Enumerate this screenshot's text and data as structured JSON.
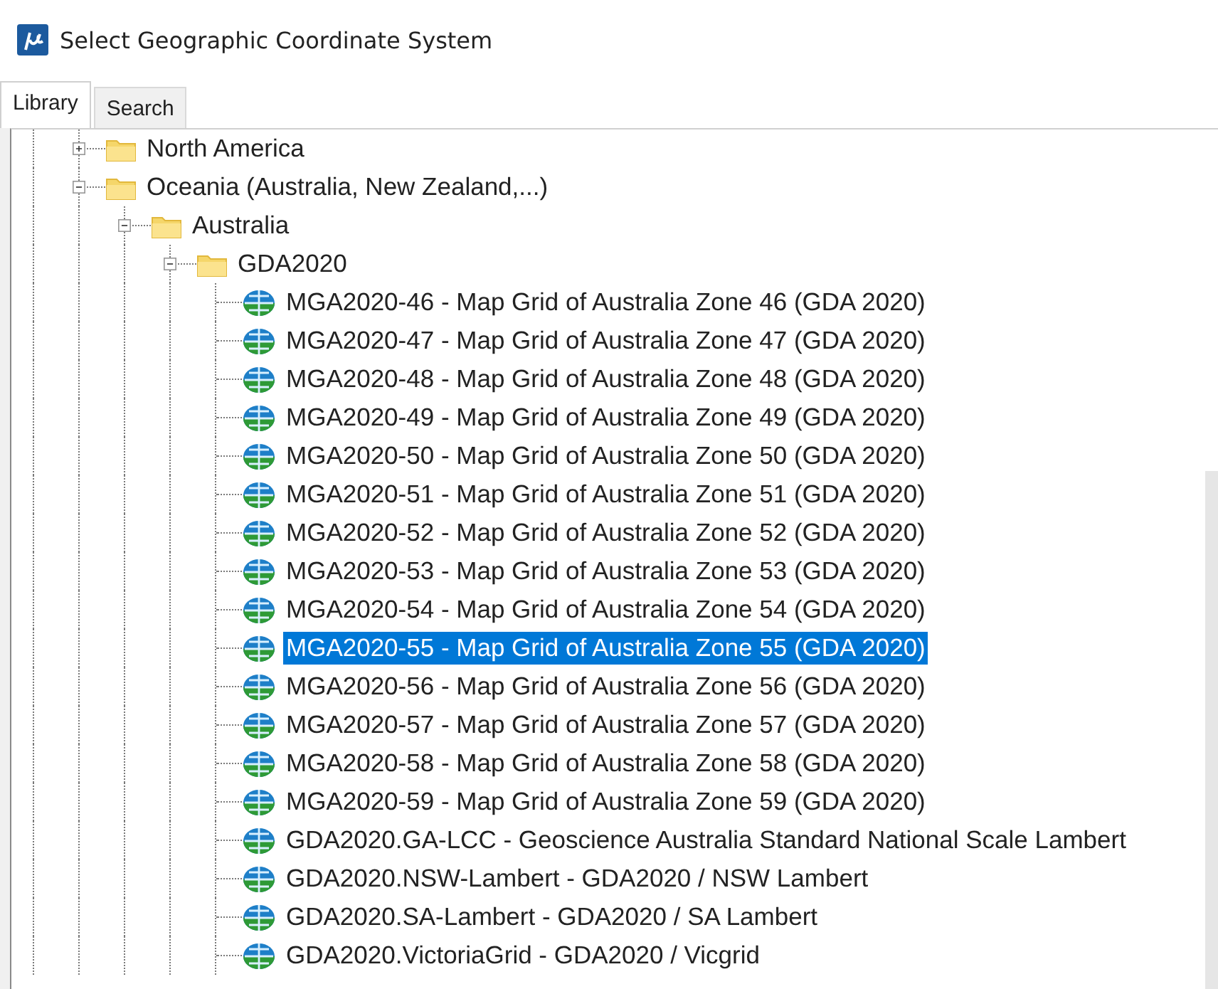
{
  "window": {
    "title": "Select Geographic Coordinate System"
  },
  "tabs": [
    {
      "label": "Library",
      "selected": true
    },
    {
      "label": "Search",
      "selected": false
    }
  ],
  "tree": [
    {
      "kind": "folder",
      "label": "North America",
      "expanded": false,
      "selected": false
    },
    {
      "kind": "folder",
      "label": "Oceania (Australia, New Zealand,...)",
      "expanded": true,
      "selected": false,
      "children": [
        {
          "kind": "folder",
          "label": "Australia",
          "expanded": true,
          "selected": false,
          "children": [
            {
              "kind": "folder",
              "label": "GDA2020",
              "expanded": true,
              "selected": false,
              "children": [
                {
                  "kind": "system",
                  "label": "MGA2020-46 - Map Grid of Australia Zone 46 (GDA 2020)",
                  "selected": false
                },
                {
                  "kind": "system",
                  "label": "MGA2020-47 - Map Grid of Australia Zone 47 (GDA 2020)",
                  "selected": false
                },
                {
                  "kind": "system",
                  "label": "MGA2020-48 - Map Grid of Australia Zone 48 (GDA 2020)",
                  "selected": false
                },
                {
                  "kind": "system",
                  "label": "MGA2020-49 - Map Grid of Australia Zone 49 (GDA 2020)",
                  "selected": false
                },
                {
                  "kind": "system",
                  "label": "MGA2020-50 - Map Grid of Australia Zone 50 (GDA 2020)",
                  "selected": false
                },
                {
                  "kind": "system",
                  "label": "MGA2020-51 - Map Grid of Australia Zone 51 (GDA 2020)",
                  "selected": false
                },
                {
                  "kind": "system",
                  "label": "MGA2020-52 - Map Grid of Australia Zone 52 (GDA 2020)",
                  "selected": false
                },
                {
                  "kind": "system",
                  "label": "MGA2020-53 - Map Grid of Australia Zone 53 (GDA 2020)",
                  "selected": false
                },
                {
                  "kind": "system",
                  "label": "MGA2020-54 - Map Grid of Australia Zone 54 (GDA 2020)",
                  "selected": false
                },
                {
                  "kind": "system",
                  "label": "MGA2020-55 - Map Grid of Australia Zone 55 (GDA 2020)",
                  "selected": true
                },
                {
                  "kind": "system",
                  "label": "MGA2020-56 - Map Grid of Australia Zone 56 (GDA 2020)",
                  "selected": false
                },
                {
                  "kind": "system",
                  "label": "MGA2020-57 - Map Grid of Australia Zone 57 (GDA 2020)",
                  "selected": false
                },
                {
                  "kind": "system",
                  "label": "MGA2020-58 - Map Grid of Australia Zone 58 (GDA 2020)",
                  "selected": false
                },
                {
                  "kind": "system",
                  "label": "MGA2020-59 - Map Grid of Australia Zone 59 (GDA 2020)",
                  "selected": false
                },
                {
                  "kind": "system",
                  "label": "GDA2020.GA-LCC - Geoscience Australia Standard National Scale Lambert",
                  "selected": false
                },
                {
                  "kind": "system",
                  "label": "GDA2020.NSW-Lambert - GDA2020 / NSW Lambert",
                  "selected": false
                },
                {
                  "kind": "system",
                  "label": "GDA2020.SA-Lambert - GDA2020 / SA Lambert",
                  "selected": false
                },
                {
                  "kind": "system",
                  "label": "GDA2020.VictoriaGrid - GDA2020 / Vicgrid",
                  "selected": false
                }
              ]
            }
          ]
        }
      ]
    }
  ]
}
